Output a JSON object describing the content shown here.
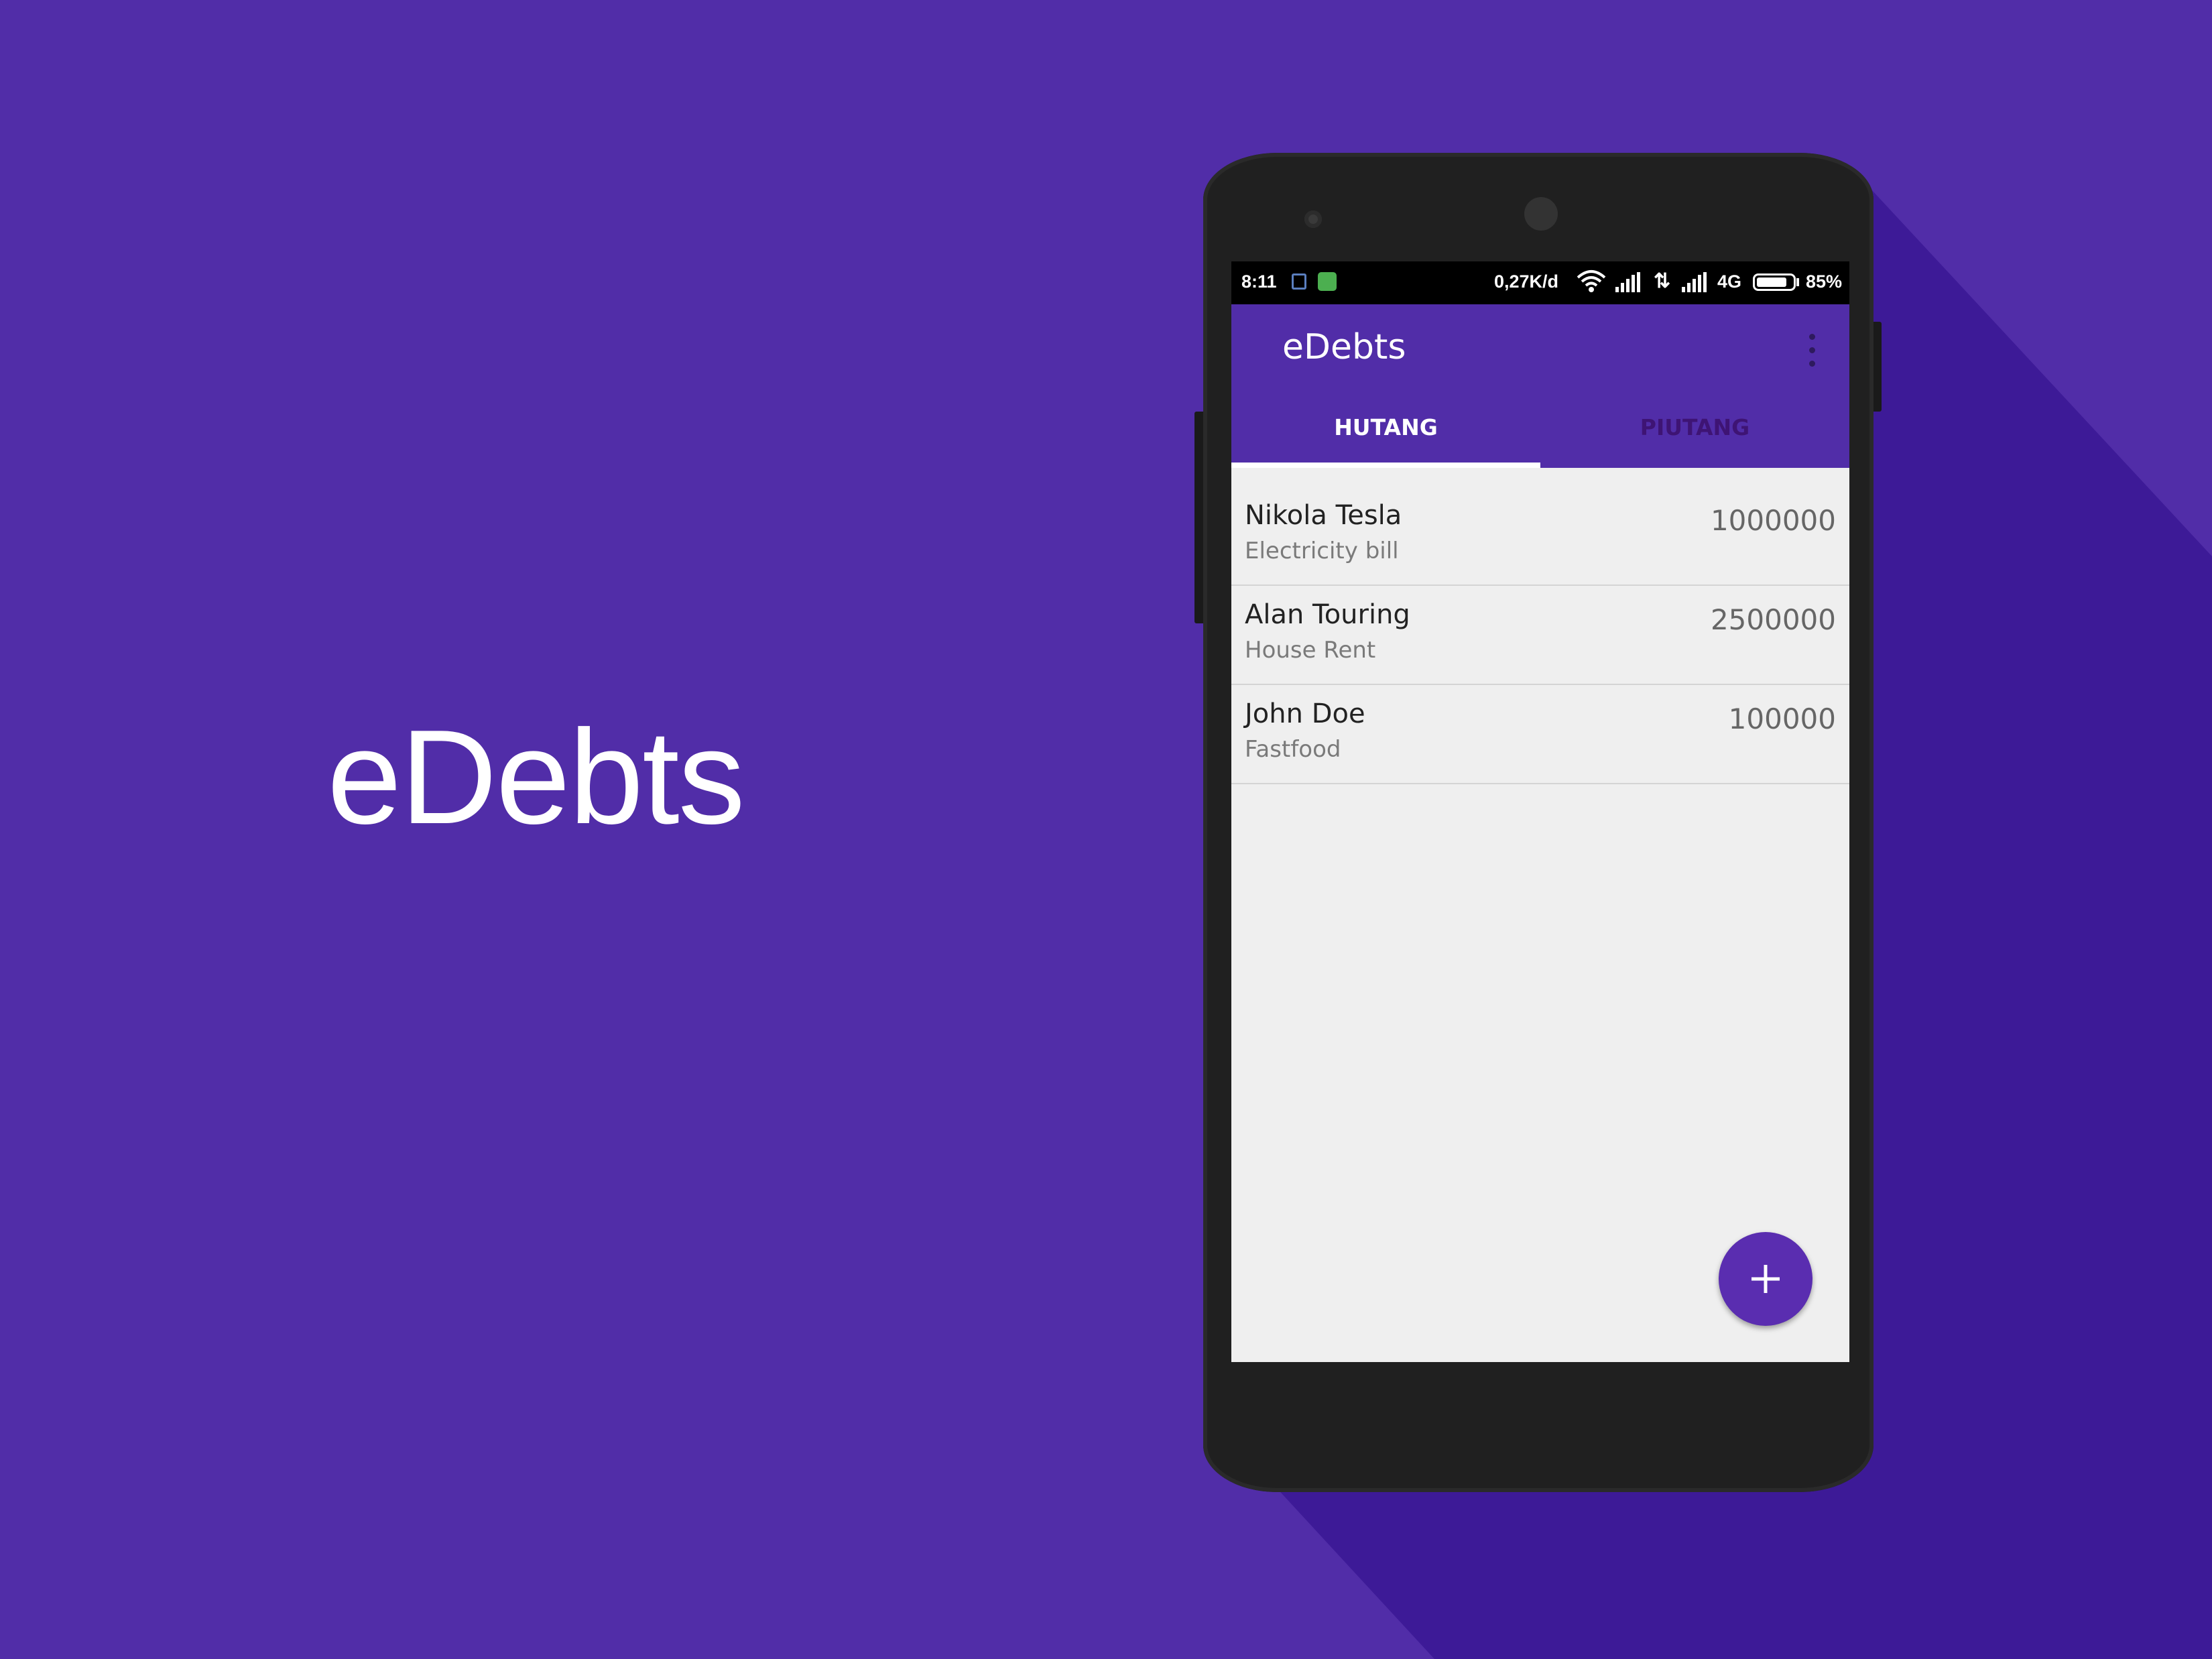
{
  "hero": {
    "title": "eDebts"
  },
  "statusbar": {
    "time": "8:11",
    "speed": "0,27K/d",
    "network": "4G",
    "battery_pct": "85%",
    "battery_level": 0.85
  },
  "appbar": {
    "title": "eDebts",
    "menu_icon": "overflow-menu-icon"
  },
  "tabs": [
    {
      "label": "HUTANG",
      "selected": true
    },
    {
      "label": "PIUTANG",
      "selected": false
    }
  ],
  "debts": [
    {
      "name": "Nikola Tesla",
      "description": "Electricity bill",
      "amount": "1000000"
    },
    {
      "name": "Alan Touring",
      "description": "House Rent",
      "amount": "2500000"
    },
    {
      "name": "John Doe",
      "description": "Fastfood",
      "amount": "100000"
    }
  ],
  "fab": {
    "icon": "plus-icon"
  },
  "colors": {
    "background": "#512da8",
    "shadow": "#3d1a97",
    "primary": "#512da8",
    "fab": "#5a2db0",
    "tab_inactive": "#3e1474",
    "list_background": "#efefef"
  }
}
